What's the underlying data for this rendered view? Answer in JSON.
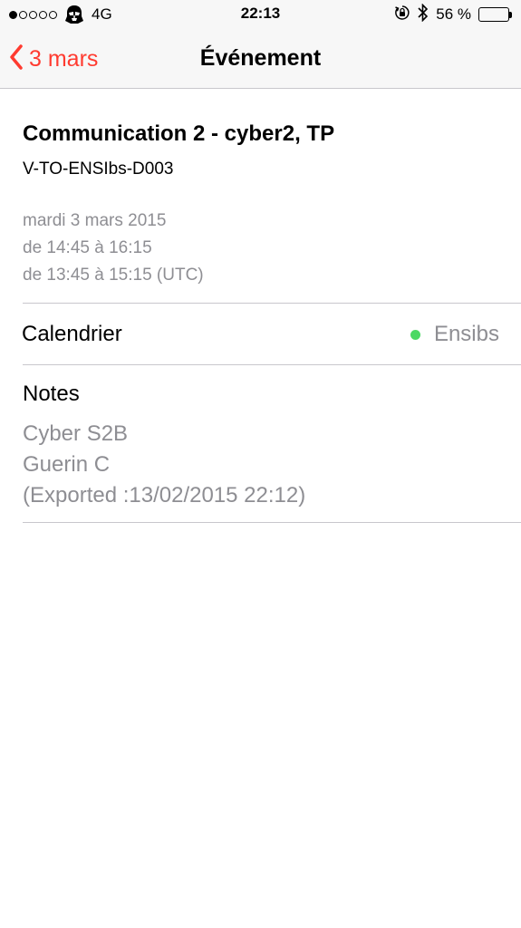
{
  "status_bar": {
    "signal_filled": 1,
    "signal_total": 5,
    "carrier_icon": "stormtrooper-icon",
    "network": "4G",
    "time": "22:13",
    "battery_percent_label": "56 %",
    "battery_level": 0.56,
    "icons": [
      "orientation-lock-icon",
      "bluetooth-icon",
      "battery-icon"
    ]
  },
  "nav": {
    "back_label": "3 mars",
    "back_icon": "chevron-left-icon",
    "title": "Événement",
    "accent_color": "#ff3b30"
  },
  "event": {
    "title": "Communication 2 - cyber2, TP",
    "location": "V-TO-ENSIbs-D003",
    "date": "mardi 3 mars 2015",
    "time": "de 14:45 à 16:15",
    "time_utc": "de 13:45 à 15:15 (UTC)"
  },
  "calendar": {
    "label": "Calendrier",
    "value": "Ensibs",
    "dot_color": "#4cd964"
  },
  "notes": {
    "label": "Notes",
    "lines": [
      "Cyber S2B",
      "Guerin C",
      "(Exported :13/02/2015 22:12)"
    ]
  }
}
